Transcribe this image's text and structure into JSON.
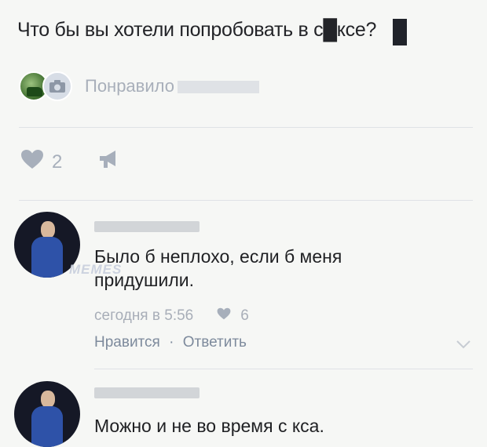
{
  "post": {
    "text": "Что бы вы хотели попробовать в с█ксе?",
    "liked_by": "Понравило"
  },
  "actions": {
    "likes_count": "2"
  },
  "comments": [
    {
      "text": "Было б неплохо, если б меня придушили.",
      "time": "сегодня в 5:56",
      "likes": "6",
      "like_action": "Нравится",
      "separator": "·",
      "reply_action": "Ответить",
      "watermark": "MEMES"
    },
    {
      "text": "Можно и не во время с  кса."
    }
  ],
  "colors": {
    "background": "#f6f7f5",
    "muted": "#a8aeb8",
    "link": "#7d8a9c"
  }
}
